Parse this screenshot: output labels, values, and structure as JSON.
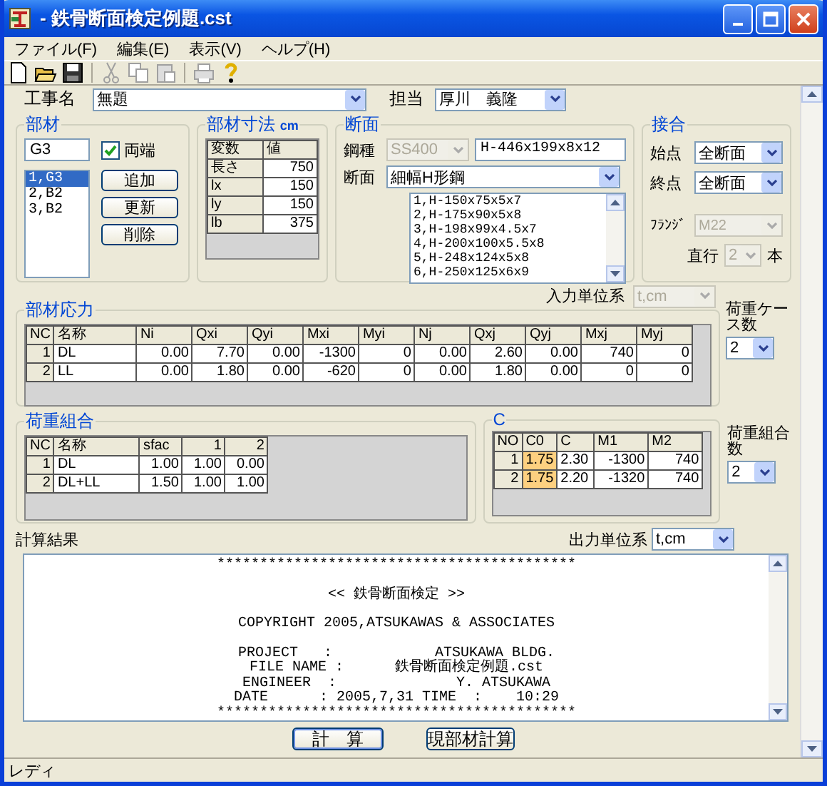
{
  "window": {
    "title": "- 鉄骨断面検定例題.cst"
  },
  "menu": [
    "ファイル(F)",
    "編集(E)",
    "表示(V)",
    "ヘルプ(H)"
  ],
  "toolbar": [
    [
      {
        "kind": "new",
        "disabled": false
      },
      {
        "kind": "open",
        "disabled": false
      },
      {
        "kind": "save",
        "disabled": false
      }
    ],
    [
      {
        "kind": "cut",
        "disabled": true
      },
      {
        "kind": "copy",
        "disabled": true
      },
      {
        "kind": "paste",
        "disabled": true
      }
    ],
    [
      {
        "kind": "print",
        "disabled": true
      },
      {
        "kind": "help",
        "disabled": false
      }
    ]
  ],
  "project": {
    "label": "工事名",
    "value": "無題"
  },
  "engineer": {
    "label": "担当",
    "value": "厚川　義隆"
  },
  "member": {
    "title": "部材",
    "name": "G3",
    "both_ends": {
      "label": "両端",
      "checked": true
    },
    "items": [
      {
        "label": "1,G3",
        "selected": true
      },
      {
        "label": "2,B2",
        "selected": false
      },
      {
        "label": "3,B2",
        "selected": false
      }
    ],
    "buttons": [
      "追加",
      "更新",
      "削除"
    ]
  },
  "dimensions": {
    "title": "部材寸法",
    "unit": "cm",
    "columns": [
      "変数",
      "値"
    ],
    "rows": [
      [
        "長さ",
        "750"
      ],
      [
        "lx",
        "150"
      ],
      [
        "ly",
        "150"
      ],
      [
        "lb",
        "375"
      ]
    ]
  },
  "section": {
    "title": "断面",
    "steel_label": "鋼種",
    "steel_value": "SS400",
    "steel_disabled": true,
    "designation": "H-446x199x8x12",
    "shape_label": "断面",
    "shape_value": "細幅H形鋼",
    "list": [
      "1,H-150x75x5x7",
      "2,H-175x90x5x8",
      "3,H-198x99x4.5x7",
      "4,H-200x100x5.5x8",
      "5,H-248x124x5x8",
      "6,H-250x125x6x9"
    ]
  },
  "joint": {
    "title": "接合",
    "start_label": "始点",
    "start_value": "全断面",
    "end_label": "終点",
    "end_value": "全断面",
    "flange_label": "ﾌﾗﾝｼﾞ",
    "flange_value": "M22",
    "flange_disabled": true,
    "rows_label": "直行",
    "rows_value": "2",
    "rows_disabled": true,
    "rows_unit": "本"
  },
  "input_units": {
    "label": "入力単位系",
    "value": "t,cm",
    "disabled": true
  },
  "member_forces": {
    "title": "部材応力",
    "columns": [
      "NC",
      "名称",
      "Ni",
      "Qxi",
      "Qyi",
      "Mxi",
      "Myi",
      "Nj",
      "Qxj",
      "Qyj",
      "Mxj",
      "Myj"
    ],
    "rows": [
      [
        "1",
        "DL",
        "0.00",
        "7.70",
        "0.00",
        "-1300",
        "0",
        "0.00",
        "2.60",
        "0.00",
        "740",
        "0"
      ],
      [
        "2",
        "LL",
        "0.00",
        "1.80",
        "0.00",
        "-620",
        "0",
        "0.00",
        "1.80",
        "0.00",
        "0",
        "0"
      ]
    ]
  },
  "load_cases": {
    "label": "荷重ケース数",
    "value": "2"
  },
  "load_combinations": {
    "title": "荷重組合",
    "columns": [
      "NC",
      "名称",
      "sfac",
      "1",
      "2"
    ],
    "rows": [
      [
        "1",
        "DL",
        "1.00",
        "1.00",
        "0.00"
      ],
      [
        "2",
        "DL+LL",
        "1.50",
        "1.00",
        "1.00"
      ]
    ]
  },
  "c_table": {
    "title": "C",
    "columns": [
      {
        "label": "NO",
        "highlighted": false
      },
      {
        "label": "C0",
        "highlighted": true
      },
      {
        "label": "C",
        "highlighted": false
      },
      {
        "label": "M1",
        "highlighted": false
      },
      {
        "label": "M2",
        "highlighted": false
      }
    ],
    "rows": [
      [
        "1",
        "1.75",
        "2.30",
        "-1300",
        "740"
      ],
      [
        "2",
        "1.75",
        "2.20",
        "-1320",
        "740"
      ]
    ]
  },
  "combo_count": {
    "label": "荷重組合数",
    "value": "2"
  },
  "results": {
    "title": "計算結果",
    "units_label": "出力単位系",
    "units_value": "t,cm",
    "blocks": [
      [
        "******************************************"
      ],
      [
        "<< 鉄骨断面検定 >>"
      ],
      [
        "COPYRIGHT 2005,ATSUKAWAS & ASSOCIATES"
      ],
      [
        "PROJECT   :            ATSUKAWA BLDG.",
        "FILE NAME :      鉄骨断面検定例題.cst",
        "ENGINEER  :              Y. ATSUKAWA",
        "DATE      : 2005,7,31 TIME  :    10:29",
        "******************************************"
      ]
    ]
  },
  "buttons": [
    "計　算",
    "現部材計算"
  ],
  "status_bar": "レディ"
}
